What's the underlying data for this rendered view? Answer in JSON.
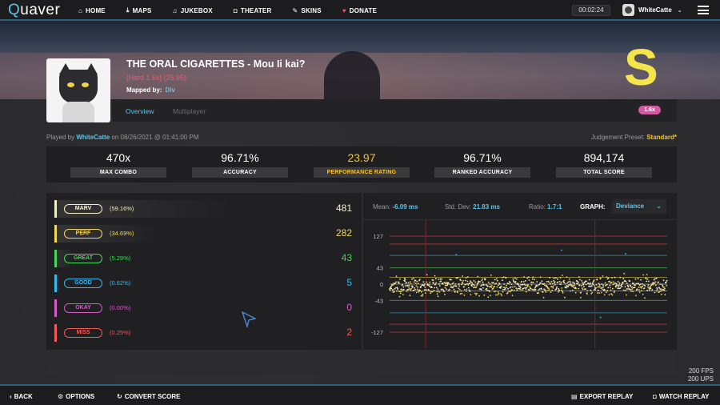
{
  "topnav": {
    "logo_q": "Q",
    "logo_rest": "uaver",
    "items": [
      {
        "icon": "home-icon",
        "glyph": "⌂",
        "label": "HOME"
      },
      {
        "icon": "download-icon",
        "glyph": "⤓",
        "label": "MAPS"
      },
      {
        "icon": "music-icon",
        "glyph": "♫",
        "label": "JUKEBOX"
      },
      {
        "icon": "camera-icon",
        "glyph": "◘",
        "label": "THEATER"
      },
      {
        "icon": "brush-icon",
        "glyph": "✎",
        "label": "SKINS"
      },
      {
        "icon": "heart-icon",
        "glyph": "♥",
        "label": "DONATE"
      }
    ],
    "timer": "00:02:24",
    "username": "WhiteCatte"
  },
  "song": {
    "title": "THE ORAL CIGARETTES - Mou Ii kai?",
    "difficulty": "[Hard 1.6x] (25.95)",
    "mapped_label": "Mapped by:",
    "mapper": "Div",
    "grade": "S"
  },
  "tabs": {
    "overview": "Overview",
    "multiplayer": "Multiplayer",
    "rate_badge": "1.6x"
  },
  "played": {
    "prefix": "Played by",
    "user": "WhiteCatte",
    "when": "on 08/26/2021 @ 01:41:00 PM",
    "preset_label": "Judgement Preset:",
    "preset_value": "Standard*"
  },
  "stats": [
    {
      "value": "470x",
      "label": "MAX COMBO"
    },
    {
      "value": "96.71%",
      "label": "ACCURACY"
    },
    {
      "value": "23.97",
      "label": "PERFORMANCE RATING"
    },
    {
      "value": "96.71%",
      "label": "RANKED ACCURACY"
    },
    {
      "value": "894,174",
      "label": "TOTAL SCORE"
    }
  ],
  "judgements": [
    {
      "name": "MARV",
      "pct": "(59.16%)",
      "count": "481",
      "color": "#f2f0c8",
      "fill": 0.59
    },
    {
      "name": "PERF",
      "pct": "(34.69%)",
      "count": "282",
      "color": "#f4d85a",
      "fill": 0.35
    },
    {
      "name": "GREAT",
      "pct": "(5.29%)",
      "count": "43",
      "color": "#46d65a",
      "fill": 0.05
    },
    {
      "name": "GOOD",
      "pct": "(0.62%)",
      "count": "5",
      "color": "#3ab8f0",
      "fill": 0.01
    },
    {
      "name": "OKAY",
      "pct": "(0.00%)",
      "count": "0",
      "color": "#d65ac8",
      "fill": 0.0
    },
    {
      "name": "MISS",
      "pct": "(0.25%)",
      "count": "2",
      "color": "#f05a5a",
      "fill": 0.0
    }
  ],
  "graph": {
    "mean_label": "Mean:",
    "mean": "-6.09 ms",
    "std_label": "Std. Dev:",
    "std": "21.83 ms",
    "ratio_label": "Ratio:",
    "ratio": "1.7:1",
    "graph_label": "GRAPH:",
    "graph_value": "Deviance",
    "ticks": [
      "127",
      "43",
      "0",
      "-43",
      "-127"
    ]
  },
  "chart_data": {
    "type": "scatter",
    "ylim": [
      -127,
      127
    ],
    "yticks": [
      127,
      43,
      0,
      -43,
      -127
    ],
    "thresholds": [
      {
        "value": 127,
        "color": "#b03a3a"
      },
      {
        "value": 106,
        "color": "#b03a3a"
      },
      {
        "value": 76,
        "color": "#3a8ab0"
      },
      {
        "value": 43,
        "color": "#3a9a4a"
      },
      {
        "value": 18,
        "color": "#b0a03a"
      },
      {
        "value": -18,
        "color": "#b0a03a"
      },
      {
        "value": -43,
        "color": "#3a9a4a"
      },
      {
        "value": -76,
        "color": "#3a8ab0"
      },
      {
        "value": -106,
        "color": "#b03a3a"
      },
      {
        "value": -127,
        "color": "#b03a3a"
      }
    ],
    "miss_markers": [
      0.13,
      0.74
    ]
  },
  "bottom": {
    "back": "BACK",
    "options": "OPTIONS",
    "convert": "CONVERT SCORE",
    "export": "EXPORT REPLAY",
    "watch": "WATCH REPLAY"
  },
  "fps": {
    "fps": "200 FPS",
    "ups": "200 UPS"
  }
}
